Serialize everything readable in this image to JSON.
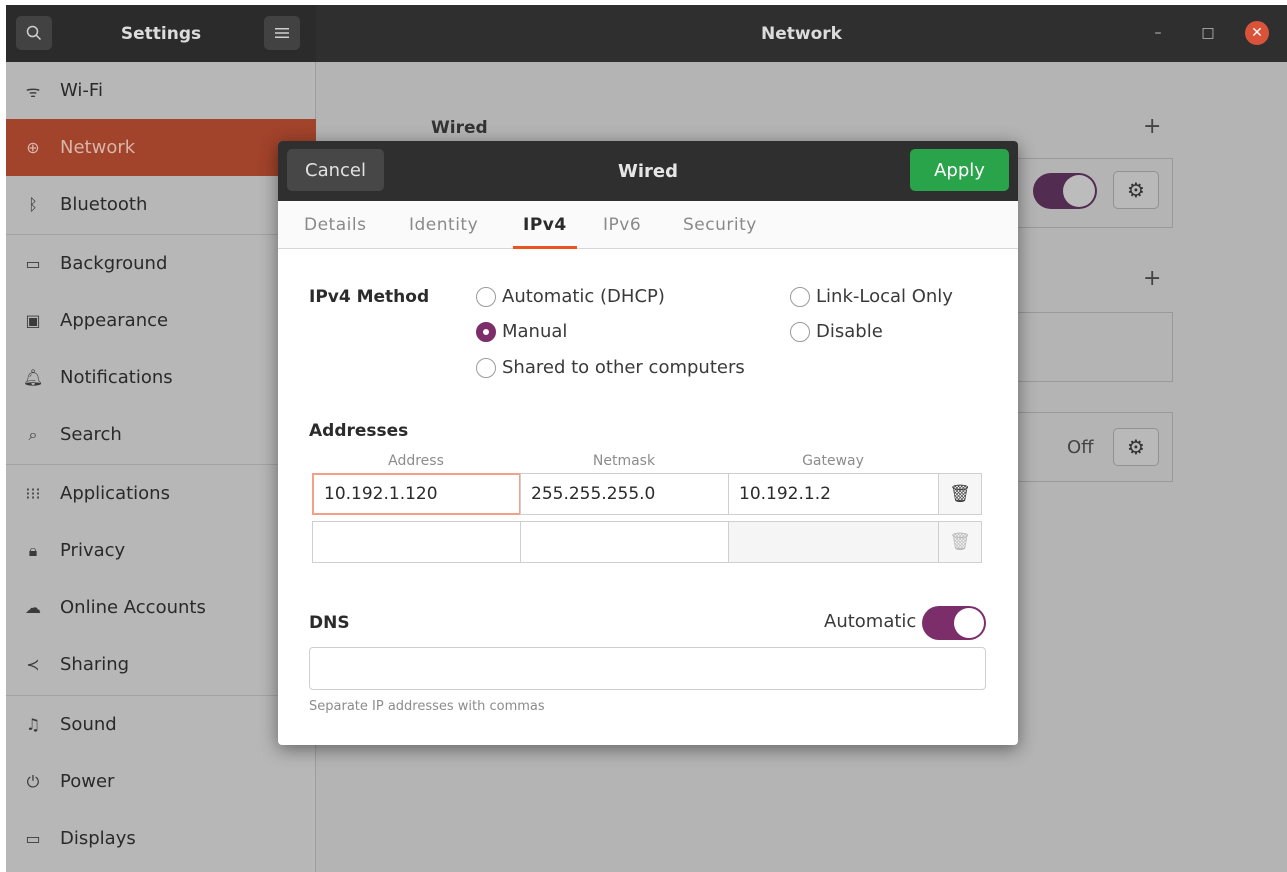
{
  "header": {
    "sidebar_title": "Settings",
    "main_title": "Network",
    "search_icon": "search-icon",
    "menu_icon": "hamburger-menu-icon"
  },
  "sidebar": {
    "items": [
      {
        "label": "Wi-Fi",
        "icon": "wifi-icon"
      },
      {
        "label": "Network",
        "icon": "network-icon"
      },
      {
        "label": "Bluetooth",
        "icon": "bluetooth-icon"
      },
      {
        "label": "Background",
        "icon": "background-icon"
      },
      {
        "label": "Appearance",
        "icon": "appearance-icon"
      },
      {
        "label": "Notifications",
        "icon": "bell-icon"
      },
      {
        "label": "Search",
        "icon": "search-icon"
      },
      {
        "label": "Applications",
        "icon": "grid-icon"
      },
      {
        "label": "Privacy",
        "icon": "lock-icon"
      },
      {
        "label": "Online Accounts",
        "icon": "cloud-icon"
      },
      {
        "label": "Sharing",
        "icon": "share-icon"
      },
      {
        "label": "Sound",
        "icon": "music-note-icon"
      },
      {
        "label": "Power",
        "icon": "power-icon"
      },
      {
        "label": "Displays",
        "icon": "display-icon"
      }
    ],
    "active_index": 1
  },
  "background": {
    "wired_label": "Wired",
    "off_label": "Off"
  },
  "dialog": {
    "title": "Wired",
    "cancel_label": "Cancel",
    "apply_label": "Apply",
    "tabs": [
      "Details",
      "Identity",
      "IPv4",
      "IPv6",
      "Security"
    ],
    "active_tab": "IPv4",
    "method_label": "IPv4 Method",
    "methods": {
      "automatic": "Automatic (DHCP)",
      "link_local": "Link-Local Only",
      "manual": "Manual",
      "disable": "Disable",
      "shared": "Shared to other computers"
    },
    "selected_method": "Manual",
    "addresses_label": "Addresses",
    "columns": [
      "Address",
      "Netmask",
      "Gateway"
    ],
    "rows": [
      {
        "address": "10.192.1.120",
        "netmask": "255.255.255.0",
        "gateway": "10.192.1.2"
      },
      {
        "address": "",
        "netmask": "",
        "gateway": ""
      }
    ],
    "dns_label": "DNS",
    "dns_automatic_label": "Automatic",
    "dns_automatic_on": true,
    "dns_value": "",
    "dns_hint": "Separate IP addresses with commas"
  },
  "colors": {
    "accent": "#e95420",
    "active_sidebar": "#a2432b",
    "apply": "#2aa44a",
    "toggle": "#7c2e6b"
  }
}
